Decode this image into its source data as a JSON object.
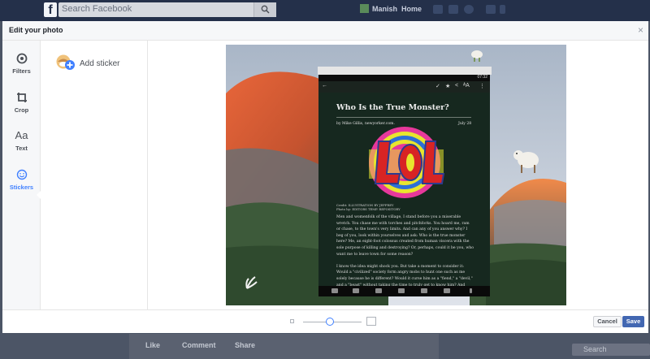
{
  "facebook": {
    "search_placeholder": "Search Facebook",
    "user_name": "Manish",
    "home_label": "Home",
    "post_actions": [
      "Like",
      "Comment",
      "Share"
    ],
    "sidebar_search": "Search"
  },
  "modal": {
    "title": "Edit your photo",
    "close": "×",
    "tools": [
      {
        "label": "Filters",
        "icon": "filters-icon"
      },
      {
        "label": "Crop",
        "icon": "crop-icon"
      },
      {
        "label": "Text",
        "icon": "text-icon",
        "glyph": "Aa"
      },
      {
        "label": "Stickers",
        "icon": "smiley-icon",
        "active": true
      }
    ],
    "add_sticker_label": "Add sticker",
    "cancel_label": "Cancel",
    "save_label": "Save",
    "zoom_level": 0.4
  },
  "article": {
    "title": "Who Is the True Monster?",
    "byline": "by Mike Gillis, newyorker.com.",
    "date": "July 28",
    "credit": "Credit: ILLUSTRATION BY JEFFREY\nPhoto by: EDITORS TEMP. REPOSITORY",
    "status_time": "07:32",
    "body": "Men and womenfolk of the village, I stand before you a miserable wretch. You chase me with torches and pitchforks. You hoard me, ram or chase, to the town's very limits. And can any of you answer why? I beg of you, look within yourselves and ask: Who is the true monster here? Me, an eight-foot colossus created from human viscera with the sole purpose of killing and destroying? Or, perhaps, could it be you, who want me to leave town for some reason?\n\nI know the idea might shock you. But take a moment to consider it: Would a \"civilized\" society form angry mobs to hunt one such as me solely because he is different? Would it curse him as a \"fiend,\" a \"devil,\" and a \"beast\" without taking the time to truly get to know him? And what did I do to deserve this? Besides inadvertently crushing your mayor's head to one of"
  },
  "colors": {
    "fb_blue": "#24304a",
    "accent": "#4080ff",
    "save_button": "#4267b2"
  }
}
